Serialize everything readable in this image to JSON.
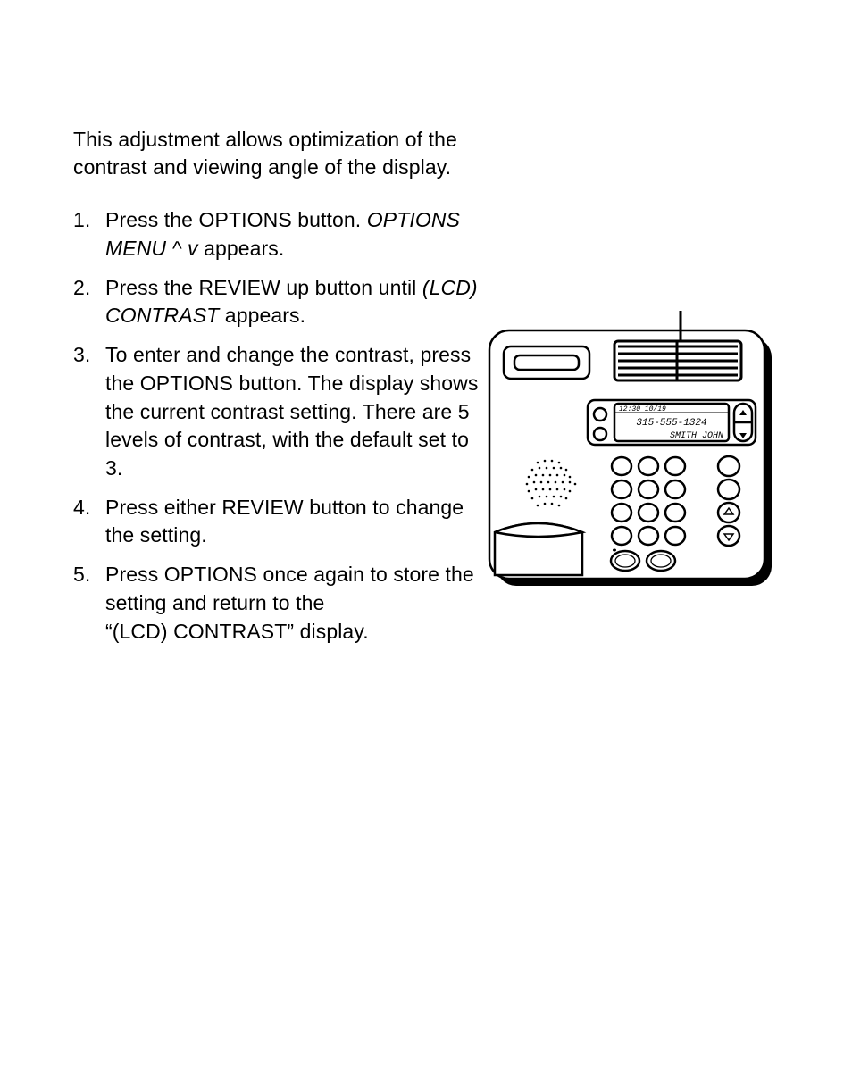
{
  "intro": "This adjustment allows optimization of the contrast and viewing angle of the display.",
  "steps": [
    {
      "num": "1.",
      "pre": "Press the OPTIONS button. ",
      "ital": "OPTIONS MENU ^ v",
      "post": " appears."
    },
    {
      "num": "2.",
      "pre": "Press the REVIEW up button until ",
      "ital": "(LCD) CONTRAST",
      "post": " appears."
    },
    {
      "num": "3.",
      "pre": "To enter and change the contrast, press the OPTIONS button. The display shows the current contrast setting. There are 5 levels of contrast, with the default set to 3.",
      "ital": "",
      "post": ""
    },
    {
      "num": "4.",
      "pre": "Press either REVIEW button to change the setting.",
      "ital": "",
      "post": ""
    },
    {
      "num": "5.",
      "pre": "Press OPTIONS once again to store the setting and return to the “(LCD) CONTRAST” display.",
      "ital": "",
      "post": ""
    }
  ],
  "device_display": {
    "line1": "12:30  10/19",
    "line2": "315-555-1324",
    "line3": "SMITH JOHN"
  }
}
